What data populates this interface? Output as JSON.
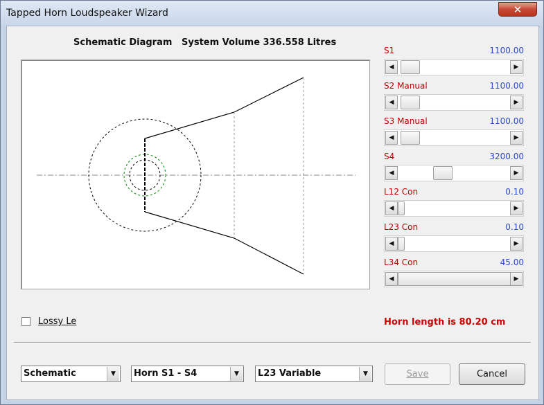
{
  "window": {
    "title": "Tapped Horn Loudspeaker Wizard",
    "close_glyph": "✕"
  },
  "diagram": {
    "heading": "Schematic Diagram   System Volume 336.558 Litres"
  },
  "sliders": [
    {
      "label": "S1",
      "value": "1100.00",
      "level": 0.03
    },
    {
      "label": "S2  Manual",
      "value": "1100.00",
      "level": 0.03
    },
    {
      "label": "S3  Manual",
      "value": "1100.00",
      "level": 0.03
    },
    {
      "label": "S4",
      "value": "3200.00",
      "level": 0.38
    },
    {
      "label": "L12  Con",
      "value": "0.10",
      "level": 0.0
    },
    {
      "label": "L23  Con",
      "value": "0.10",
      "level": 0.0
    },
    {
      "label": "L34  Con",
      "value": "45.00",
      "level": 1.0
    }
  ],
  "lossy": {
    "label": "Lossy Le",
    "checked": false
  },
  "horn_length": "Horn length is 80.20 cm",
  "combos": [
    {
      "name": "view-mode-combo",
      "value": "Schematic"
    },
    {
      "name": "horn-section-combo",
      "value": "Horn S1 - S4"
    },
    {
      "name": "variable-combo",
      "value": "L23 Variable"
    }
  ],
  "buttons": {
    "save": "Save",
    "cancel": "Cancel"
  },
  "icons": {
    "arrow_left": "◀",
    "arrow_right": "▶",
    "arrow_down": "▼"
  }
}
